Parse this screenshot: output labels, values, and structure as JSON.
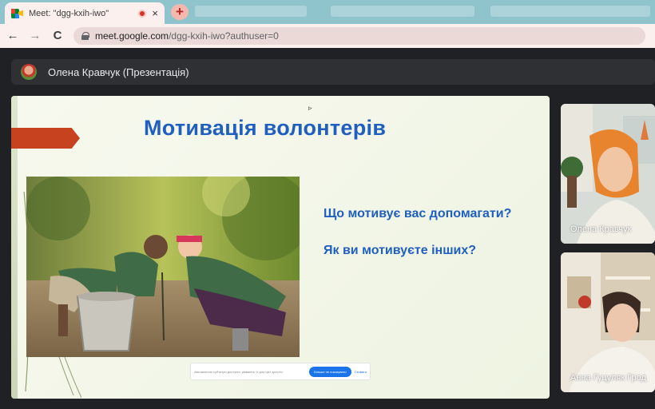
{
  "browser": {
    "active_tab_title": "Meet: \"dgg-kxih-iwo\"",
    "close_glyph": "×",
    "new_tab_glyph": "+",
    "back_glyph": "←",
    "forward_glyph": "→",
    "reload_glyph": "C",
    "url_host": "meet.google.com",
    "url_path": "/dgg-kxih-iwo?authuser=0"
  },
  "meet": {
    "presenter_label": "Олена Кравчук (Презентація)",
    "participants": [
      {
        "name": "Олена Кравчук"
      },
      {
        "name": "Анна Гуцуляк Грод"
      }
    ]
  },
  "slide": {
    "title": "Мотивація волонтерів",
    "question_1": "Що мотивує вас допомагати?",
    "question_2": "Як ви мотивуєте інших?",
    "caption_text": "Автоматичні субтитри доступні, увімкніть їх для цієї зустрічі",
    "caption_button": "Більше не показувати",
    "caption_link": "Сховати"
  },
  "colors": {
    "tabbar": "#8fc4cc",
    "chrome": "#fbf0ee",
    "meet_bg": "#202124",
    "title_blue": "#1f5fbf",
    "banner_orange": "#c7421f"
  },
  "icons": [
    "meet-logo-icon",
    "record-icon",
    "close-icon",
    "plus-icon",
    "back-arrow-icon",
    "forward-arrow-icon",
    "reload-icon",
    "lock-icon"
  ]
}
